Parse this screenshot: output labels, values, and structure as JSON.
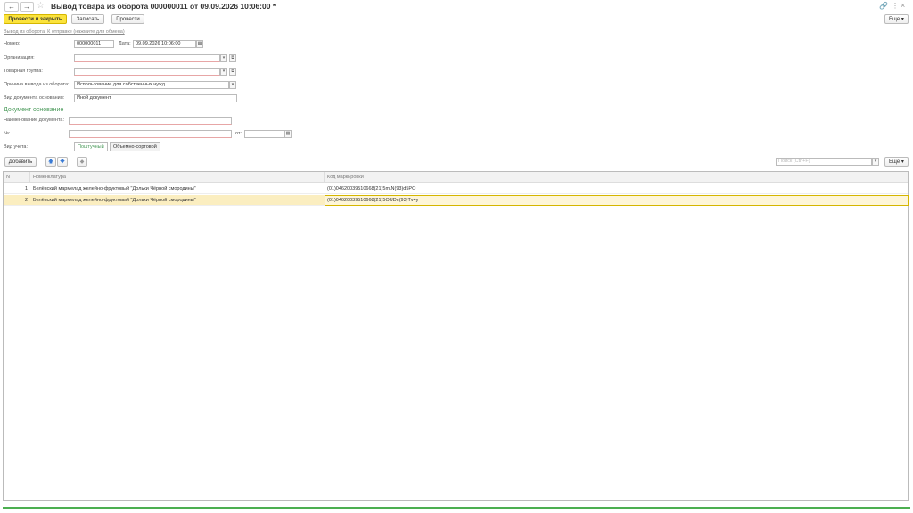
{
  "window": {
    "title": "Вывод товара из оборота 000000011 от 09.09.2026 10:06:00 *",
    "more_label": "Еще ▾"
  },
  "toolbar": {
    "post_close_label": "Провести и закрыть",
    "save_label": "Записать",
    "post_label": "Провести"
  },
  "status_link": "Вывод из оборота: К отправке (нажмите для обмена)",
  "form": {
    "number_label": "Номер:",
    "number_value": "000000011",
    "date_label": "Дата:",
    "date_value": "09.09.2026 10:06:00",
    "org_label": "Организация:",
    "org_value": "",
    "group_label": "Товарная группа:",
    "group_value": "",
    "reason_label": "Причина вывода из оборота:",
    "reason_value": "Использование для собственных нужд",
    "doc_kind_label": "Вид документа основания:",
    "doc_kind_value": "Иной документ"
  },
  "base_doc": {
    "section_title": "Документ основание",
    "name_label": "Наименование документа:",
    "name_value": "",
    "num_label": "№:",
    "num_value": "",
    "from_label": "от:",
    "from_value": ". .",
    "accounting_label": "Вид учета:",
    "mode_piece": "Поштучный",
    "mode_bulk": "Объемно-сортовой"
  },
  "table_toolbar": {
    "add_label": "Добавить",
    "search_placeholder": "Поиск (Ctrl+F)",
    "more_label": "Еще ▾"
  },
  "table": {
    "columns": [
      "N",
      "Номенклатура",
      "Код маркировки"
    ],
    "rows": [
      {
        "n": "1",
        "item": "Белёвский мармелад желейно-фруктовый \"Дольки Чёрной смородины\"",
        "code": "(01)04620039510668(21)5m.N(93)d5PO"
      },
      {
        "n": "2",
        "item": "Белёвский мармелад желейно-фруктовый \"Дольки Чёрной смородины\"",
        "code": "(01)04620039510668(21)5OUDn(93)Tv4y"
      }
    ]
  },
  "colors": {
    "accent": "#fbe33c",
    "section_green": "#4a9a5a",
    "selected_row": "#fbeec0"
  }
}
